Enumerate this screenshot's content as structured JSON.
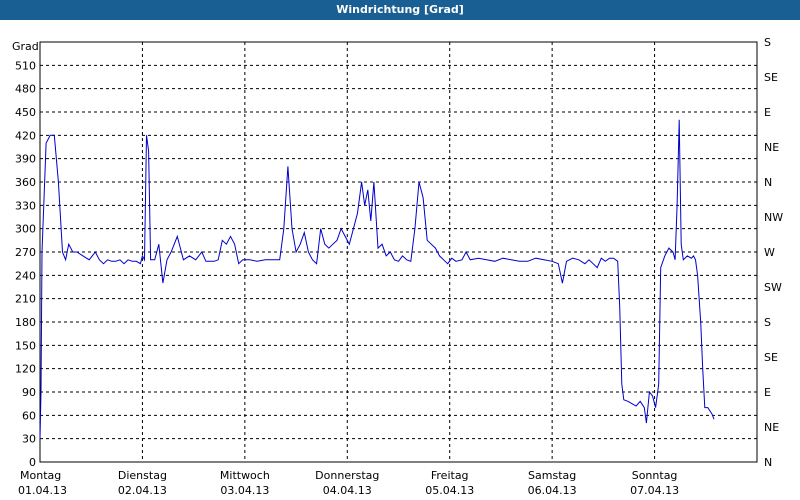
{
  "window_title": "Windrichtung [Grad]",
  "chart_data": {
    "type": "line",
    "title": "Windrichtung [Grad]",
    "ylabel": "Grad",
    "ylim": [
      0,
      540
    ],
    "y_ticks": [
      0,
      30,
      60,
      90,
      120,
      150,
      180,
      210,
      240,
      270,
      300,
      330,
      360,
      390,
      420,
      450,
      480,
      510
    ],
    "right_axis_labels": [
      "N",
      "NE",
      "E",
      "SE",
      "S",
      "SW",
      "W",
      "NW",
      "N",
      "NE",
      "E",
      "SE",
      "S"
    ],
    "x_ticks": [
      {
        "day": "Montag",
        "date": "01.04.13"
      },
      {
        "day": "Dienstag",
        "date": "02.04.13"
      },
      {
        "day": "Mittwoch",
        "date": "03.04.13"
      },
      {
        "day": "Donnerstag",
        "date": "04.04.13"
      },
      {
        "day": "Freitag",
        "date": "05.04.13"
      },
      {
        "day": "Samstag",
        "date": "06.04.13"
      },
      {
        "day": "Sonntag",
        "date": "07.04.13"
      }
    ],
    "x_unit": "days",
    "xlim": [
      0,
      7
    ],
    "grid": true,
    "line_color": "#0000cc",
    "series": [
      {
        "values": [
          [
            0.0,
            30
          ],
          [
            0.01,
            90
          ],
          [
            0.02,
            270
          ],
          [
            0.06,
            410
          ],
          [
            0.1,
            420
          ],
          [
            0.14,
            420
          ],
          [
            0.18,
            360
          ],
          [
            0.22,
            270
          ],
          [
            0.25,
            260
          ],
          [
            0.28,
            280
          ],
          [
            0.32,
            270
          ],
          [
            0.36,
            270
          ],
          [
            0.42,
            265
          ],
          [
            0.48,
            260
          ],
          [
            0.54,
            270
          ],
          [
            0.58,
            260
          ],
          [
            0.62,
            255
          ],
          [
            0.66,
            260
          ],
          [
            0.7,
            258
          ],
          [
            0.74,
            258
          ],
          [
            0.78,
            260
          ],
          [
            0.82,
            255
          ],
          [
            0.86,
            260
          ],
          [
            0.9,
            258
          ],
          [
            0.94,
            258
          ],
          [
            0.98,
            255
          ],
          [
            1.0,
            265
          ],
          [
            1.02,
            260
          ],
          [
            1.04,
            420
          ],
          [
            1.06,
            400
          ],
          [
            1.08,
            260
          ],
          [
            1.12,
            260
          ],
          [
            1.16,
            280
          ],
          [
            1.2,
            230
          ],
          [
            1.24,
            260
          ],
          [
            1.28,
            270
          ],
          [
            1.34,
            290
          ],
          [
            1.4,
            260
          ],
          [
            1.46,
            265
          ],
          [
            1.52,
            260
          ],
          [
            1.58,
            270
          ],
          [
            1.62,
            258
          ],
          [
            1.66,
            258
          ],
          [
            1.7,
            258
          ],
          [
            1.74,
            260
          ],
          [
            1.78,
            285
          ],
          [
            1.82,
            280
          ],
          [
            1.86,
            290
          ],
          [
            1.9,
            280
          ],
          [
            1.94,
            255
          ],
          [
            1.98,
            260
          ],
          [
            2.05,
            260
          ],
          [
            2.12,
            258
          ],
          [
            2.2,
            260
          ],
          [
            2.28,
            260
          ],
          [
            2.34,
            260
          ],
          [
            2.38,
            300
          ],
          [
            2.42,
            380
          ],
          [
            2.46,
            300
          ],
          [
            2.5,
            270
          ],
          [
            2.54,
            280
          ],
          [
            2.58,
            295
          ],
          [
            2.62,
            270
          ],
          [
            2.66,
            260
          ],
          [
            2.7,
            255
          ],
          [
            2.74,
            300
          ],
          [
            2.78,
            280
          ],
          [
            2.82,
            275
          ],
          [
            2.86,
            280
          ],
          [
            2.9,
            285
          ],
          [
            2.94,
            300
          ],
          [
            2.98,
            290
          ],
          [
            3.02,
            280
          ],
          [
            3.06,
            300
          ],
          [
            3.1,
            320
          ],
          [
            3.14,
            360
          ],
          [
            3.17,
            330
          ],
          [
            3.2,
            350
          ],
          [
            3.23,
            310
          ],
          [
            3.26,
            360
          ],
          [
            3.3,
            275
          ],
          [
            3.34,
            280
          ],
          [
            3.38,
            265
          ],
          [
            3.42,
            270
          ],
          [
            3.46,
            260
          ],
          [
            3.5,
            258
          ],
          [
            3.54,
            265
          ],
          [
            3.58,
            260
          ],
          [
            3.62,
            258
          ],
          [
            3.66,
            300
          ],
          [
            3.7,
            360
          ],
          [
            3.74,
            340
          ],
          [
            3.78,
            285
          ],
          [
            3.82,
            280
          ],
          [
            3.86,
            275
          ],
          [
            3.9,
            265
          ],
          [
            3.94,
            260
          ],
          [
            3.98,
            255
          ],
          [
            4.02,
            262
          ],
          [
            4.06,
            258
          ],
          [
            4.12,
            260
          ],
          [
            4.16,
            270
          ],
          [
            4.2,
            260
          ],
          [
            4.28,
            262
          ],
          [
            4.36,
            260
          ],
          [
            4.44,
            258
          ],
          [
            4.52,
            262
          ],
          [
            4.6,
            260
          ],
          [
            4.68,
            258
          ],
          [
            4.76,
            258
          ],
          [
            4.84,
            262
          ],
          [
            4.92,
            260
          ],
          [
            5.0,
            258
          ],
          [
            5.06,
            255
          ],
          [
            5.1,
            230
          ],
          [
            5.14,
            258
          ],
          [
            5.2,
            262
          ],
          [
            5.26,
            260
          ],
          [
            5.32,
            255
          ],
          [
            5.36,
            260
          ],
          [
            5.4,
            255
          ],
          [
            5.44,
            250
          ],
          [
            5.48,
            262
          ],
          [
            5.52,
            258
          ],
          [
            5.56,
            262
          ],
          [
            5.6,
            262
          ],
          [
            5.64,
            258
          ],
          [
            5.66,
            200
          ],
          [
            5.68,
            100
          ],
          [
            5.7,
            80
          ],
          [
            5.74,
            78
          ],
          [
            5.78,
            75
          ],
          [
            5.82,
            72
          ],
          [
            5.86,
            78
          ],
          [
            5.9,
            70
          ],
          [
            5.92,
            50
          ],
          [
            5.95,
            90
          ],
          [
            5.98,
            85
          ],
          [
            6.01,
            70
          ],
          [
            6.04,
            100
          ],
          [
            6.06,
            250
          ],
          [
            6.1,
            265
          ],
          [
            6.14,
            275
          ],
          [
            6.18,
            270
          ],
          [
            6.2,
            260
          ],
          [
            6.22,
            330
          ],
          [
            6.24,
            440
          ],
          [
            6.26,
            280
          ],
          [
            6.28,
            260
          ],
          [
            6.32,
            265
          ],
          [
            6.36,
            262
          ],
          [
            6.38,
            265
          ],
          [
            6.4,
            260
          ],
          [
            6.42,
            240
          ],
          [
            6.45,
            180
          ],
          [
            6.47,
            120
          ],
          [
            6.49,
            70
          ],
          [
            6.52,
            70
          ],
          [
            6.56,
            62
          ],
          [
            6.58,
            55
          ]
        ]
      }
    ]
  }
}
